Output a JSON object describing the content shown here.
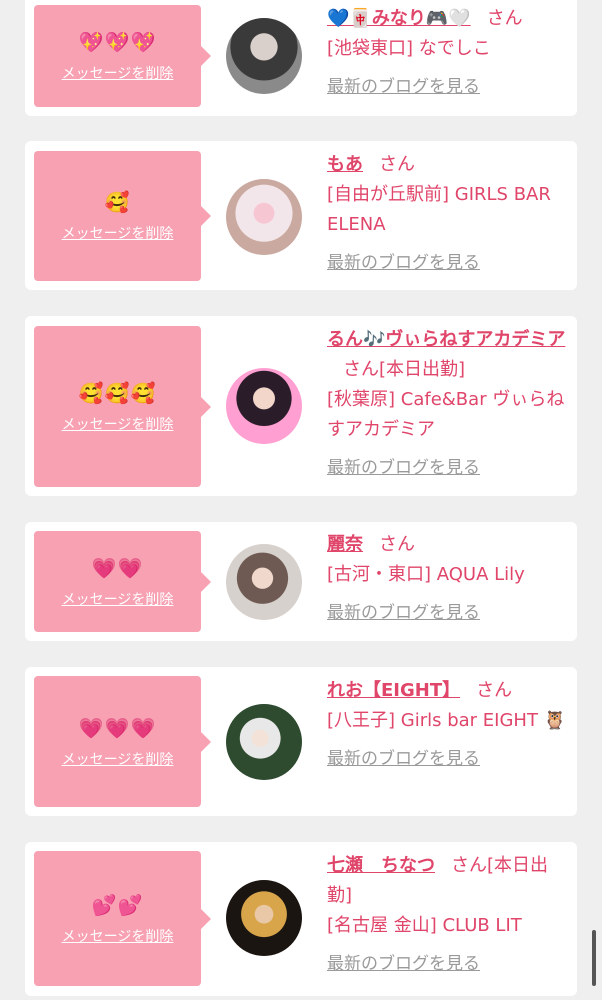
{
  "delete_label": "メッセージを削除",
  "blog_label": "最新のブログを見る",
  "messages": [
    {
      "emoji": "💖💖💖",
      "name": "💙🀄みなり🎮🤍",
      "honorific": "さん",
      "shop": "[池袋東口] なでしこ",
      "avatar_colors": [
        "#3a3a3a",
        "#8a8a8a"
      ]
    },
    {
      "emoji": "🥰",
      "name": "もあ",
      "honorific": "さん",
      "shop": "[自由が丘駅前] GIRLS BAR ELENA",
      "avatar_colors": [
        "#f3e6ea",
        "#e7b8c4"
      ]
    },
    {
      "emoji": "🥰🥰🥰",
      "name": "るん🎶ヴぃらねすアカデミア",
      "honorific": "さん[本日出勤]",
      "shop": "[秋葉原] Cafe&Bar ヴぃらねすアカデミア",
      "avatar_colors": [
        "#ff9fd2",
        "#2b1c2a"
      ]
    },
    {
      "emoji": "💗💗",
      "name": "麗奈",
      "honorific": "さん",
      "shop": "[古河・東口] AQUA Lily",
      "avatar_colors": [
        "#d7d1cd",
        "#6e5a52"
      ]
    },
    {
      "emoji": "💗💗💗",
      "name": "れお【EIGHT】",
      "honorific": "さん",
      "shop": "[八王子] Girls bar EIGHT 🦉",
      "avatar_colors": [
        "#2e4a2f",
        "#e8e8e8"
      ]
    },
    {
      "emoji": "💕💕",
      "name": "七瀬　ちなつ",
      "honorific": "さん[本日出勤]",
      "shop": "[名古屋 金山] CLUB LIT",
      "avatar_colors": [
        "#1b1512",
        "#d9a54a"
      ]
    }
  ]
}
